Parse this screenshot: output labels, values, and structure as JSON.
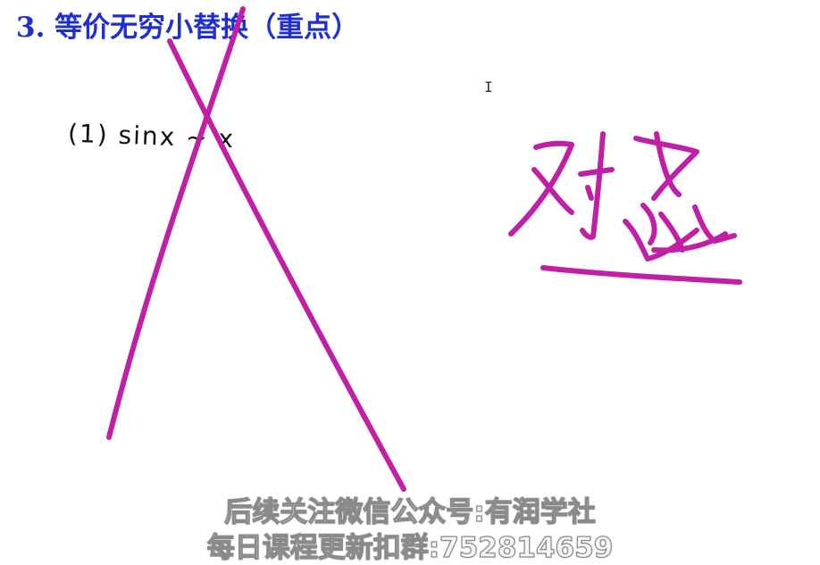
{
  "slide": {
    "title": "3. 等价无穷小替换（重点）",
    "handwritten_line": "(1) sinx ~ x"
  },
  "annotations": {
    "cursor_glyph": "I",
    "ink_color": "#c21fa7",
    "title_color": "#1f2fd6"
  },
  "overlay": {
    "line1": "后续关注微信公众号:有润学社",
    "line2": "每日课程更新扣群:752814659"
  }
}
